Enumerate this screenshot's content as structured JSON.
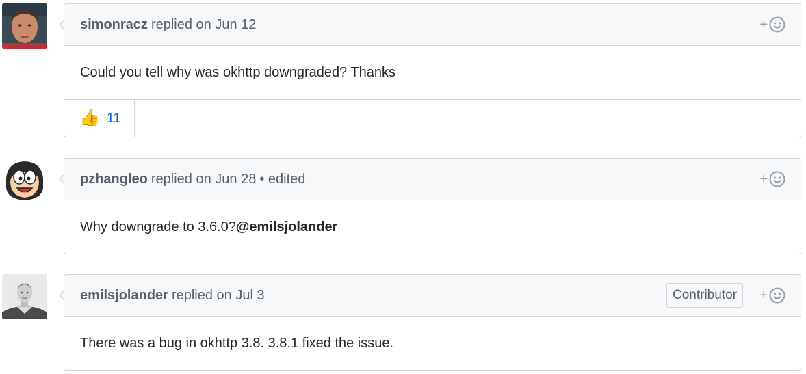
{
  "comments": [
    {
      "author": "simonracz",
      "meta": "replied on Jun 12",
      "body": "Could you tell why was okhttp downgraded? Thanks",
      "reaction": {
        "emoji": "👍",
        "count": "11"
      },
      "reaction_icon": "thumbs-up-icon"
    },
    {
      "author": "pzhangleo",
      "meta": "replied on Jun 28",
      "edited": "• edited",
      "body_text": "Why downgrade to 3.6.0?",
      "body_mention": "@emilsjolander"
    },
    {
      "author": "emilsjolander",
      "meta": "replied on Jul 3",
      "badge": "Contributor",
      "body": "There was a bug in okhttp 3.8. 3.8.1 fixed the issue."
    }
  ],
  "add_reaction_label": "+",
  "colors": {
    "link": "#0366d6",
    "border": "#d1d5da",
    "header_bg": "#f6f8fa",
    "muted": "#586069"
  }
}
